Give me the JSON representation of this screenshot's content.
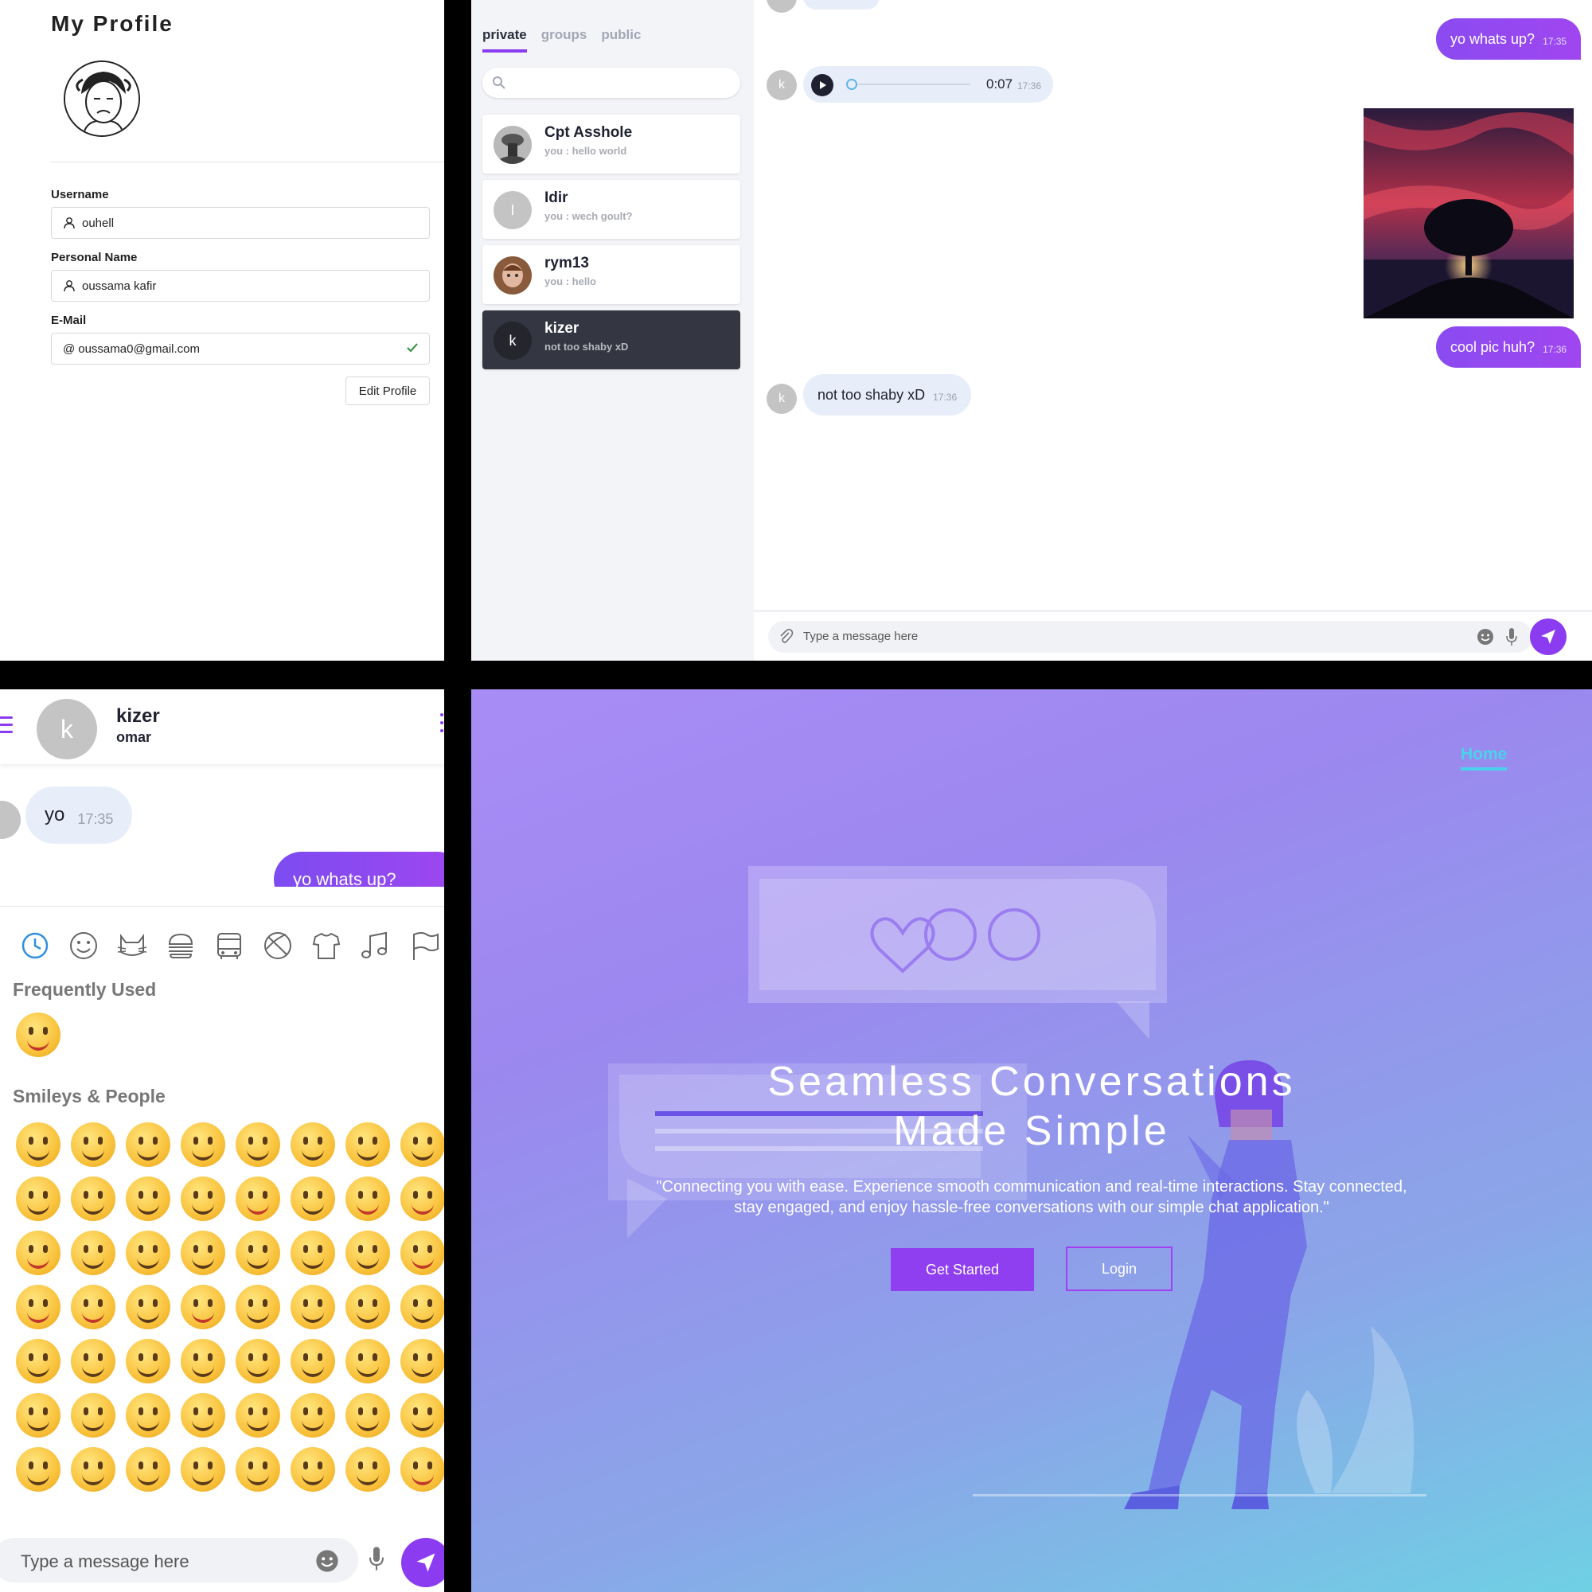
{
  "profile": {
    "title": "My Profile",
    "username_label": "Username",
    "username_value": "ouhell",
    "personal_name_label": "Personal Name",
    "personal_name_value": "oussama kafir",
    "email_label": "E-Mail",
    "email_prefix": "@",
    "email_value": "oussama0@gmail.com",
    "edit_button": "Edit Profile"
  },
  "chat_desktop": {
    "tabs": [
      {
        "label": "private",
        "active": true
      },
      {
        "label": "groups",
        "active": false
      },
      {
        "label": "public",
        "active": false
      }
    ],
    "contacts": [
      {
        "name": "Cpt Asshole",
        "preview": "you : hello world",
        "avatar": "photo"
      },
      {
        "name": "Idir",
        "preview": "you : wech goult?",
        "avatar": "I"
      },
      {
        "name": "rym13",
        "preview": "you : hello",
        "avatar": "photo"
      },
      {
        "name": "kizer",
        "preview": "not too shaby xD",
        "avatar": "k",
        "active": true
      }
    ],
    "messages": {
      "out1_text": "yo whats up?",
      "out1_time": "17:35",
      "voice_avatar": "k",
      "voice_duration": "0:07",
      "voice_time": "17:36",
      "out2_text": "cool pic huh?",
      "out2_time": "17:36",
      "in_avatar": "k",
      "in_text": "not too shaby xD",
      "in_time": "17:36"
    },
    "composer_placeholder": "Type a message here"
  },
  "mobile": {
    "contact_avatar": "k",
    "contact_name": "kizer",
    "contact_sub": "omar",
    "in_text": "yo",
    "in_time": "17:35",
    "out_text": "yo whats up?",
    "emoji_categories": [
      "recent-icon",
      "smiley-icon",
      "cat-icon",
      "burger-icon",
      "bus-icon",
      "ball-icon",
      "shirt-icon",
      "music-icon",
      "flag-icon"
    ],
    "frequently_used_label": "Frequently Used",
    "smileys_label": "Smileys & People",
    "composer_placeholder": "Type a message here"
  },
  "landing": {
    "nav_home": "Home",
    "title": "Seamless Conversations Made Simple",
    "subtitle": "\"Connecting you with ease. Experience smooth communication and real-time interactions. Stay connected, stay engaged, and enjoy hassle-free conversations with our simple chat application.\"",
    "get_started": "Get Started",
    "login": "Login"
  },
  "colors": {
    "accent": "#8b3cf0",
    "dark": "#343641",
    "bubble_in": "#e7eef9",
    "cyan": "#4ad2ec"
  }
}
